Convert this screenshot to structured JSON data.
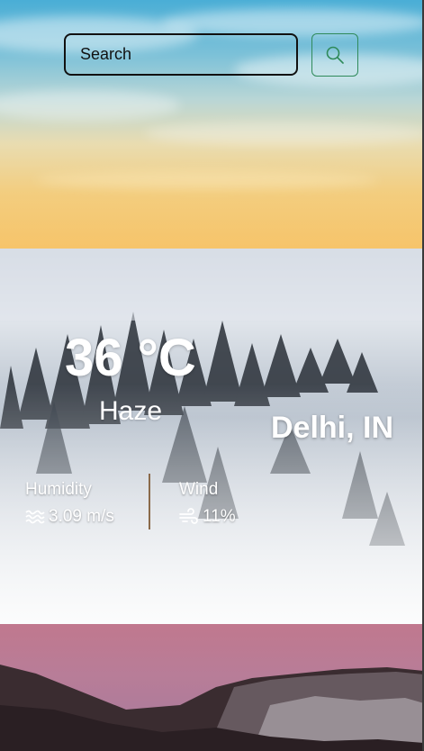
{
  "search": {
    "placeholder": "Search",
    "button_icon": "search-icon",
    "button_icon_color": "#2f8a5a"
  },
  "weather": {
    "temperature": "36 °C",
    "condition": "Haze",
    "city": "Delhi, IN"
  },
  "stats": {
    "humidity_label": "Humidity",
    "humidity_value": "3.09 m/s",
    "humidity_icon": "waves-icon",
    "wind_label": "Wind",
    "wind_value": "11%",
    "wind_icon": "wind-icon"
  }
}
